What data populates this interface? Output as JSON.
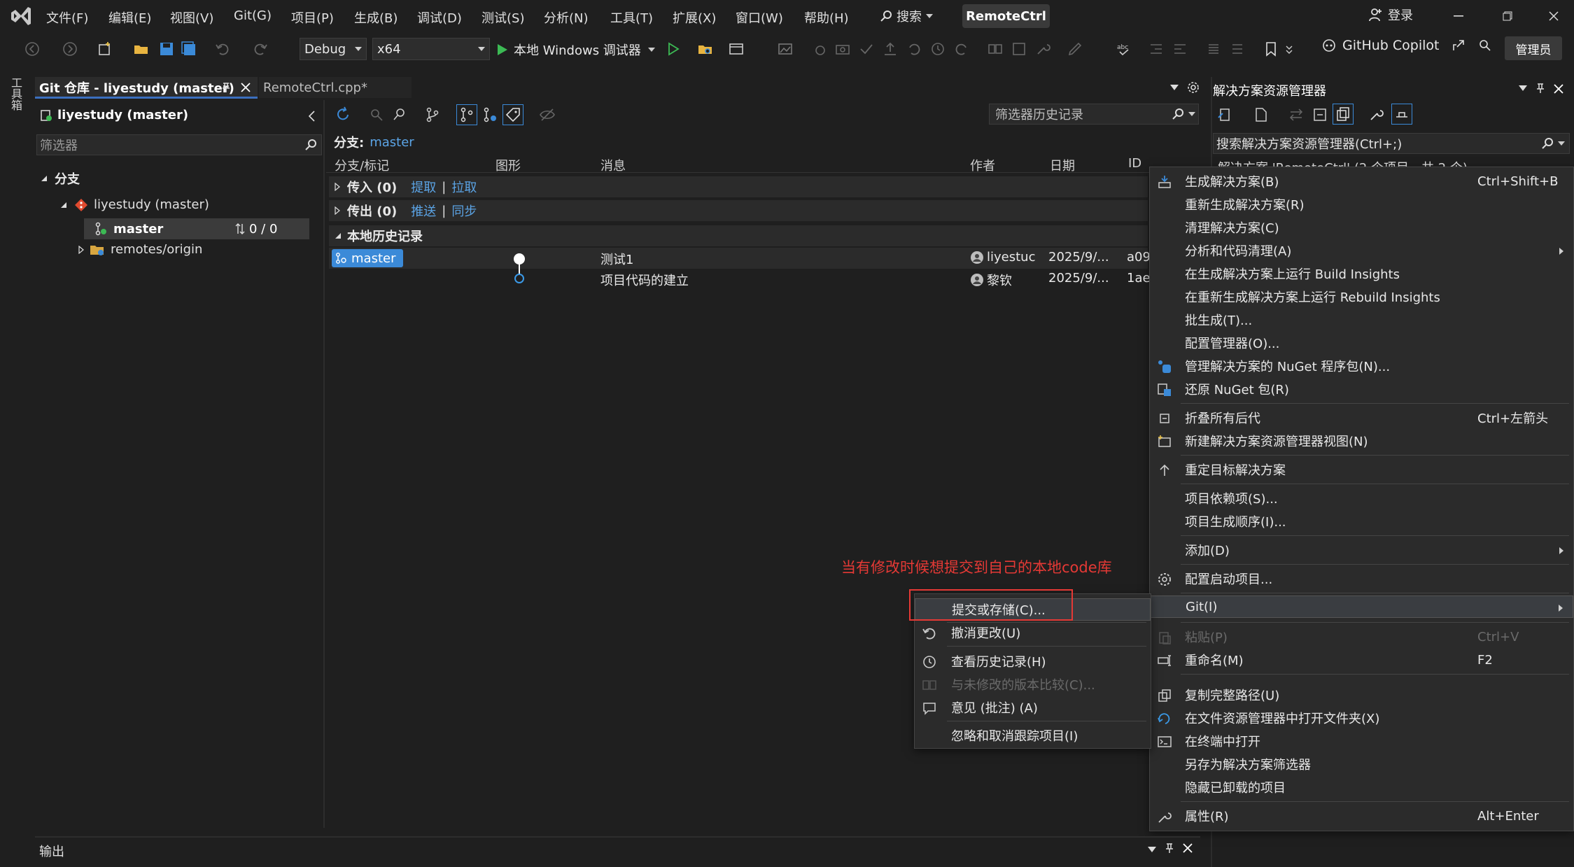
{
  "menubar": {
    "items": [
      "文件(F)",
      "编辑(E)",
      "视图(V)",
      "Git(G)",
      "项目(P)",
      "生成(B)",
      "调试(D)",
      "测试(S)",
      "分析(N)",
      "工具(T)",
      "扩展(X)",
      "窗口(W)",
      "帮助(H)"
    ],
    "search_label": "搜索",
    "solution_name": "RemoteCtrl",
    "signin": "登录"
  },
  "toolbar": {
    "config": "Debug",
    "platform": "x64",
    "run_label": "本地 Windows 调试器",
    "copilot_label": "GitHub Copilot",
    "admin_label": "管理员"
  },
  "toolbox_label": "工具箱",
  "tabs": {
    "git_tab": "Git 仓库 - liyestudy (master)",
    "cpp_tab": "RemoteCtrl.cpp*"
  },
  "git_left": {
    "repo_title": "liyestudy (master)",
    "filter_placeholder": "筛选器",
    "branches_heading": "分支",
    "local_repo": "liyestudy (master)",
    "current_branch": "master",
    "sync_status": "0 / 0",
    "remotes": "remotes/origin"
  },
  "git_main": {
    "branch_label": "分支:",
    "branch_name": "master",
    "history_filter_placeholder": "筛选器历史记录",
    "columns": [
      "分支/标记",
      "图形",
      "消息",
      "作者",
      "日期",
      "ID"
    ],
    "incoming": {
      "label": "传入 (0)",
      "link1": "提取",
      "link2": "拉取"
    },
    "outgoing": {
      "label": "传出 (0)",
      "link1": "推送",
      "link2": "同步"
    },
    "local_history": "本地历史记录",
    "branch_tag": "master",
    "commits": [
      {
        "message": "测试1",
        "author": "liyestuc",
        "date": "2025/9/...",
        "id": "a09"
      },
      {
        "message": "项目代码的建立",
        "author": "黎钦",
        "date": "2025/9/...",
        "id": "1ae"
      }
    ]
  },
  "solution_explorer": {
    "title": "解决方案资源管理器",
    "search_placeholder": "搜索解决方案资源管理器(Ctrl+;)",
    "root_item": "解决方案 'RemoteCtrl' (2 个项目，共 2 个)"
  },
  "context_menu": {
    "items": [
      {
        "label": "生成解决方案(B)",
        "shortcut": "Ctrl+Shift+B",
        "icon": "build-icon"
      },
      {
        "label": "重新生成解决方案(R)",
        "shortcut": ""
      },
      {
        "label": "清理解决方案(C)",
        "shortcut": ""
      },
      {
        "label": "分析和代码清理(A)",
        "shortcut": "",
        "submenu": true
      },
      {
        "label": "在生成解决方案上运行 Build Insights",
        "shortcut": ""
      },
      {
        "label": "在重新生成解决方案上运行 Rebuild Insights",
        "shortcut": ""
      },
      {
        "label": "批生成(T)...",
        "shortcut": ""
      },
      {
        "label": "配置管理器(O)...",
        "shortcut": ""
      },
      {
        "label": "管理解决方案的 NuGet 程序包(N)...",
        "shortcut": "",
        "icon": "nuget-icon"
      },
      {
        "label": "还原 NuGet 包(R)",
        "shortcut": "",
        "icon": "restore-icon"
      },
      {
        "label": "折叠所有后代",
        "shortcut": "Ctrl+左箭头",
        "icon": "collapse-icon"
      },
      {
        "label": "新建解决方案资源管理器视图(N)",
        "shortcut": "",
        "icon": "new-view-icon"
      },
      {
        "label": "重定目标解决方案",
        "shortcut": "",
        "icon": "retarget-icon"
      },
      {
        "label": "项目依赖项(S)...",
        "shortcut": ""
      },
      {
        "label": "项目生成顺序(I)...",
        "shortcut": ""
      },
      {
        "label": "添加(D)",
        "shortcut": "",
        "submenu": true
      },
      {
        "label": "配置启动项目...",
        "shortcut": "",
        "icon": "gear-icon"
      },
      {
        "label": "Git(I)",
        "shortcut": "",
        "submenu": true
      },
      {
        "label": "粘贴(P)",
        "shortcut": "Ctrl+V",
        "icon": "paste-icon",
        "disabled": true
      },
      {
        "label": "重命名(M)",
        "shortcut": "F2",
        "icon": "rename-icon"
      },
      {
        "label": "复制完整路径(U)",
        "shortcut": "",
        "icon": "copy-icon"
      },
      {
        "label": "在文件资源管理器中打开文件夹(X)",
        "shortcut": "",
        "icon": "open-folder-icon"
      },
      {
        "label": "在终端中打开",
        "shortcut": "",
        "icon": "terminal-icon"
      },
      {
        "label": "另存为解决方案筛选器",
        "shortcut": ""
      },
      {
        "label": "隐藏已卸载的项目",
        "shortcut": ""
      },
      {
        "label": "属性(R)",
        "shortcut": "Alt+Enter",
        "icon": "wrench-icon"
      }
    ]
  },
  "git_submenu": {
    "items": [
      {
        "label": "提交或存储(C)..."
      },
      {
        "label": "撤消更改(U)",
        "icon": "undo-icon"
      },
      {
        "label": "查看历史记录(H)",
        "icon": "history-icon"
      },
      {
        "label": "与未修改的版本比较(C)...",
        "icon": "compare-icon",
        "disabled": true
      },
      {
        "label": "意见 (批注) (A)",
        "icon": "comment-icon"
      },
      {
        "label": "忽略和取消跟踪项目(I)"
      }
    ]
  },
  "annotation": "当有修改时候想提交到自己的本地code库",
  "output": {
    "title": "输出"
  },
  "colors": {
    "accent": "#3b8ad8",
    "annotation": "#e53935",
    "background": "#1f1f1f"
  }
}
